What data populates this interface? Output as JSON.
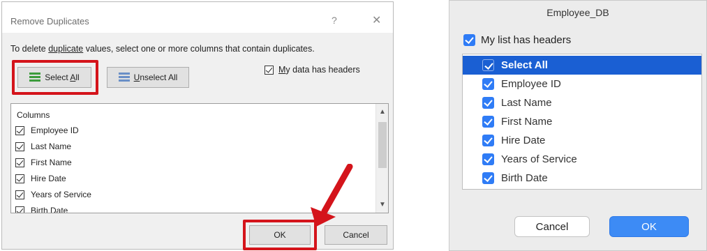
{
  "windows_dialog": {
    "title": "Remove Duplicates",
    "help_glyph": "?",
    "close_glyph": "✕",
    "instructions": {
      "before": "To delete ",
      "underlined": "duplicate",
      "after": " values, select one or more columns that contain duplicates."
    },
    "select_all": {
      "prefix": "Select ",
      "accel": "A",
      "suffix": "ll",
      "icon": "list-check-icon"
    },
    "unselect_all": {
      "accel": "U",
      "suffix": "nselect All",
      "icon": "list-icon"
    },
    "my_data_has_headers": {
      "accel": "M",
      "suffix": "y data has headers",
      "checked": true
    },
    "columns_label": "Columns",
    "columns": [
      {
        "label": "Employee ID",
        "checked": true
      },
      {
        "label": "Last Name",
        "checked": true
      },
      {
        "label": "First Name",
        "checked": true
      },
      {
        "label": "Hire Date",
        "checked": true
      },
      {
        "label": "Years of Service",
        "checked": true
      },
      {
        "label": "Birth Date",
        "checked": true
      }
    ],
    "scroll_up_glyph": "▲",
    "scroll_down_glyph": "▼",
    "ok_label": "OK",
    "cancel_label": "Cancel",
    "highlight_color": "#d4141b"
  },
  "mac_dialog": {
    "title": "Employee_DB",
    "my_list_has_headers": {
      "label": "My list has headers",
      "checked": true
    },
    "items": [
      {
        "label": "Select All",
        "checked": true,
        "selected": true
      },
      {
        "label": "Employee ID",
        "checked": true
      },
      {
        "label": "Last Name",
        "checked": true
      },
      {
        "label": "First Name",
        "checked": true
      },
      {
        "label": "Hire Date",
        "checked": true
      },
      {
        "label": "Years of Service",
        "checked": true
      },
      {
        "label": "Birth Date",
        "checked": true
      }
    ],
    "cancel_label": "Cancel",
    "ok_label": "OK",
    "accent_color": "#2f7cf6"
  }
}
